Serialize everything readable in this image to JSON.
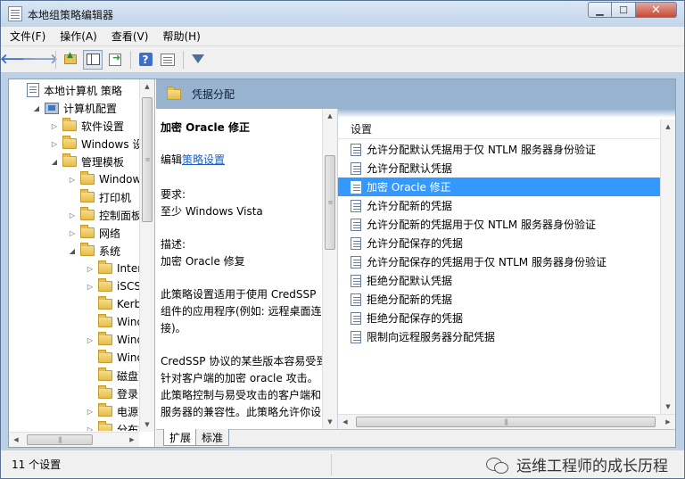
{
  "window": {
    "title": "本地组策略编辑器",
    "min_label": "▁",
    "max_label": "☐",
    "close_label": "✕"
  },
  "menu": [
    "文件(F)",
    "操作(A)",
    "查看(V)",
    "帮助(H)"
  ],
  "toolbar": {
    "back": "🡐",
    "forward": "🡒",
    "help": "?"
  },
  "tree": {
    "items": [
      {
        "label": "本地计算机 策略",
        "icon": "policy-icon",
        "expander": "",
        "indent": 0
      },
      {
        "label": "计算机配置",
        "icon": "computer-icon",
        "expander": "◢",
        "indent": 1
      },
      {
        "label": "软件设置",
        "icon": "folder-icon",
        "expander": "▷",
        "indent": 2
      },
      {
        "label": "Windows 设置",
        "icon": "folder-icon",
        "expander": "▷",
        "indent": 2
      },
      {
        "label": "管理模板",
        "icon": "folder-icon",
        "expander": "◢",
        "indent": 2
      },
      {
        "label": "Windows",
        "icon": "folder-icon",
        "expander": "▷",
        "indent": 3
      },
      {
        "label": "打印机",
        "icon": "folder-icon",
        "expander": "",
        "indent": 3
      },
      {
        "label": "控制面板",
        "icon": "folder-icon",
        "expander": "▷",
        "indent": 3
      },
      {
        "label": "网络",
        "icon": "folder-icon",
        "expander": "▷",
        "indent": 3
      },
      {
        "label": "系统",
        "icon": "folder-icon",
        "expander": "◢",
        "indent": 3
      },
      {
        "label": "Internet",
        "icon": "folder-icon",
        "expander": "▷",
        "indent": 4
      },
      {
        "label": "iSCSI",
        "icon": "folder-icon",
        "expander": "▷",
        "indent": 4
      },
      {
        "label": "Kerberos",
        "icon": "folder-icon",
        "expander": "",
        "indent": 4
      },
      {
        "label": "Windows",
        "icon": "folder-icon",
        "expander": "",
        "indent": 4
      },
      {
        "label": "Windows",
        "icon": "folder-icon",
        "expander": "▷",
        "indent": 4
      },
      {
        "label": "Windows",
        "icon": "folder-icon",
        "expander": "",
        "indent": 4
      },
      {
        "label": "磁盘配额",
        "icon": "folder-icon",
        "expander": "",
        "indent": 4
      },
      {
        "label": "登录",
        "icon": "folder-icon",
        "expander": "",
        "indent": 4
      },
      {
        "label": "电源管理",
        "icon": "folder-icon",
        "expander": "▷",
        "indent": 4
      },
      {
        "label": "分布式",
        "icon": "folder-icon",
        "expander": "▷",
        "indent": 4
      }
    ]
  },
  "header": {
    "title": "凭据分配"
  },
  "description": {
    "title": "加密 Oracle 修正",
    "edit_prefix": "编辑",
    "edit_link": "策略设置",
    "requirements_label": "要求:",
    "requirements_value": "至少 Windows Vista",
    "description_label": "描述:",
    "description_value": "加密 Oracle 修复",
    "para1": "此策略设置适用于使用 CredSSP 组件的应用程序(例如: 远程桌面连接)。",
    "para2": "CredSSP 协议的某些版本容易受到针对客户端的加密 oracle 攻击。此策略控制与易受攻击的客户端和服务器的兼容性。此策略允许你设"
  },
  "list": {
    "column_header": "设置",
    "selected_index": 2,
    "rows": [
      "允许分配默认凭据用于仅 NTLM 服务器身份验证",
      "允许分配默认凭据",
      "加密 Oracle 修正",
      "允许分配新的凭据",
      "允许分配新的凭据用于仅 NTLM 服务器身份验证",
      "允许分配保存的凭据",
      "允许分配保存的凭据用于仅 NTLM 服务器身份验证",
      "拒绝分配默认凭据",
      "拒绝分配新的凭据",
      "拒绝分配保存的凭据",
      "限制向远程服务器分配凭据"
    ]
  },
  "tabs": [
    "扩展",
    "标准"
  ],
  "status": {
    "text": "11 个设置",
    "watermark": "运维工程师的成长历程"
  }
}
